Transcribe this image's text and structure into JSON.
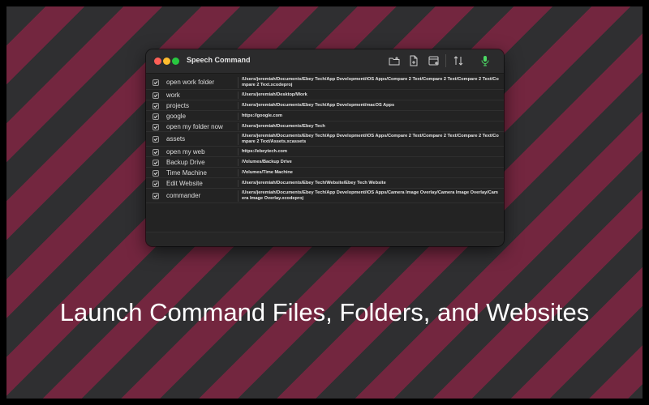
{
  "window": {
    "title": "Speech Command"
  },
  "toolbar": {
    "icons": [
      "folder-add-icon",
      "file-add-icon",
      "browser-add-icon",
      "sort-icon",
      "microphone-icon"
    ],
    "accent_mic": "#4cd964"
  },
  "colors": {
    "stripe_dark": "#2f2f31",
    "stripe_maroon": "#73263f"
  },
  "rows": [
    {
      "name": "open work folder",
      "path": "/Users/jeremiah/Documents/Ebey Tech/App Development/iOS Apps/Compare 2 Text/Compare 2 Text/Compare 2 Text/Compare 2 Text.xcodeproj",
      "checked": true
    },
    {
      "name": "work",
      "path": "/Users/jeremiah/Desktop/Work",
      "checked": true
    },
    {
      "name": "projects",
      "path": "/Users/jeremiah/Documents/Ebey Tech/App Development/macOS Apps",
      "checked": true
    },
    {
      "name": "google",
      "path": "https://google.com",
      "checked": true
    },
    {
      "name": "open my folder now",
      "path": "/Users/jeremiah/Documents/Ebey Tech",
      "checked": true
    },
    {
      "name": "assets",
      "path": "/Users/jeremiah/Documents/Ebey Tech/App Development/iOS Apps/Compare 2 Text/Compare 2 Text/Compare 2 Text/Compare 2 Text/Assets.xcassets",
      "checked": true
    },
    {
      "name": "open my web",
      "path": "https://ebeytech.com",
      "checked": true
    },
    {
      "name": "Backup Drive",
      "path": "/Volumes/Backup Drive",
      "checked": true
    },
    {
      "name": "Time Machine",
      "path": "/Volumes/Time Machine",
      "checked": true
    },
    {
      "name": "Edit Website",
      "path": "/Users/jeremiah/Documents/Ebey Tech/Website/Ebey Tech Website",
      "checked": true
    },
    {
      "name": "commander",
      "path": "/Users/jeremiah/Documents/Ebey Tech/App Development/iOS Apps/Camera Image Overlay/Camera Image Overlay/Camera Image Overlay.xcodeproj",
      "checked": true
    }
  ],
  "caption": "Launch Command Files, Folders, and Websites"
}
